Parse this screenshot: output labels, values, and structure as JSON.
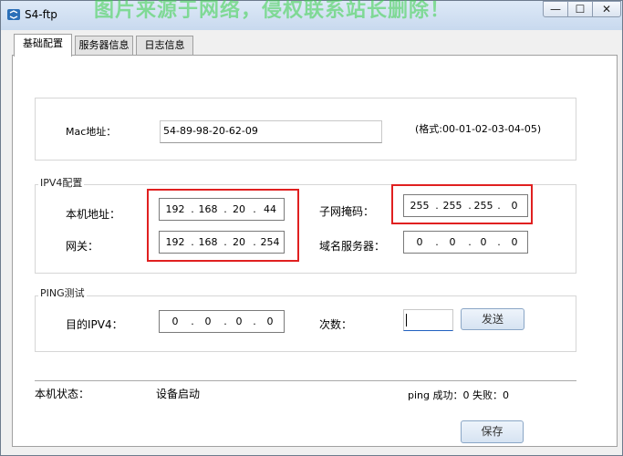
{
  "window": {
    "title": "S4-ftp",
    "watermark": "图片来源于网络，侵权联系站长删除！",
    "buttons": {
      "minimize": "—",
      "maximize": "☐",
      "close": "✕"
    }
  },
  "tabs": [
    {
      "label": "基础配置",
      "active": true
    },
    {
      "label": "服务器信息",
      "active": false
    },
    {
      "label": "日志信息",
      "active": false
    }
  ],
  "mac": {
    "label": "Mac地址：",
    "value": "54-89-98-20-62-09",
    "format_hint": "(格式:00-01-02-03-04-05)"
  },
  "ipv4": {
    "group_label": "IPV4配置",
    "ip_label": "本机地址：",
    "ip": [
      "192",
      "168",
      "20",
      "44"
    ],
    "gateway_label": "网关：",
    "gateway": [
      "192",
      "168",
      "20",
      "254"
    ],
    "mask_label": "子网掩码：",
    "mask": [
      "255",
      "255",
      "255",
      "0"
    ],
    "dns_label": "域名服务器：",
    "dns": [
      "0",
      "0",
      "0",
      "0"
    ]
  },
  "ping": {
    "group_label": "PING测试",
    "target_label": "目的IPV4：",
    "target": [
      "0",
      "0",
      "0",
      "0"
    ],
    "count_label": "次数：",
    "count_value": "",
    "send_button": "发送"
  },
  "status": {
    "label": "本机状态：",
    "value": "设备启动",
    "ping_result": "ping 成功：0 失败：0"
  },
  "save_button": "保存",
  "colors": {
    "highlight": "#e02020",
    "watermark": "#3bd24a"
  }
}
